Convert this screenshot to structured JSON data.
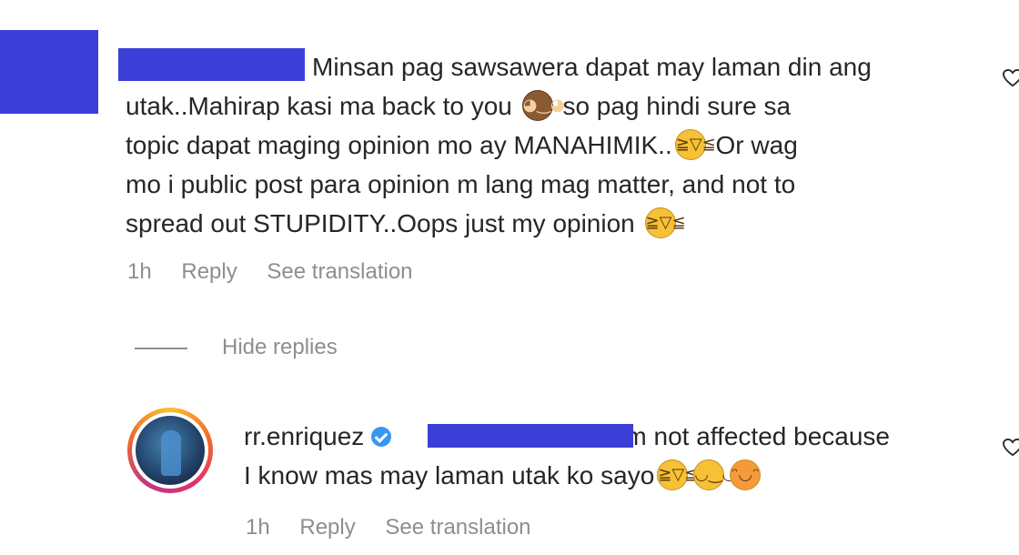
{
  "comment": {
    "lines": [
      "Minsan pag sawsawera dapat may laman din ang",
      "utak..Mahirap kasi ma back to you",
      "so pag hindi sure sa",
      "topic dapat maging opinion mo ay MANAHIMIK..",
      "Or wag",
      "mo i public post para opinion m lang mag matter, and not to",
      "spread out STUPIDITY..Oops just my opinion"
    ],
    "time": "1h",
    "reply_label": "Reply",
    "translate_label": "See translation"
  },
  "hide_replies": "Hide replies",
  "reply": {
    "username": "rr.enriquez",
    "text_part1": "I'm not affected because",
    "text_part2": "I know mas may laman utak ko sayo",
    "time": "1h",
    "reply_label": "Reply",
    "translate_label": "See translation"
  },
  "icons": {
    "emoji_monkey": "see-no-evil-monkey-icon",
    "emoji_laugh": "tears-of-joy-icon",
    "emoji_upside": "upside-down-face-icon",
    "emoji_tongue": "tongue-face-icon",
    "like": "heart-icon"
  },
  "colors": {
    "redaction": "#3b3fd8",
    "meta_text": "#8e8e8e",
    "verified": "#3897f0"
  }
}
